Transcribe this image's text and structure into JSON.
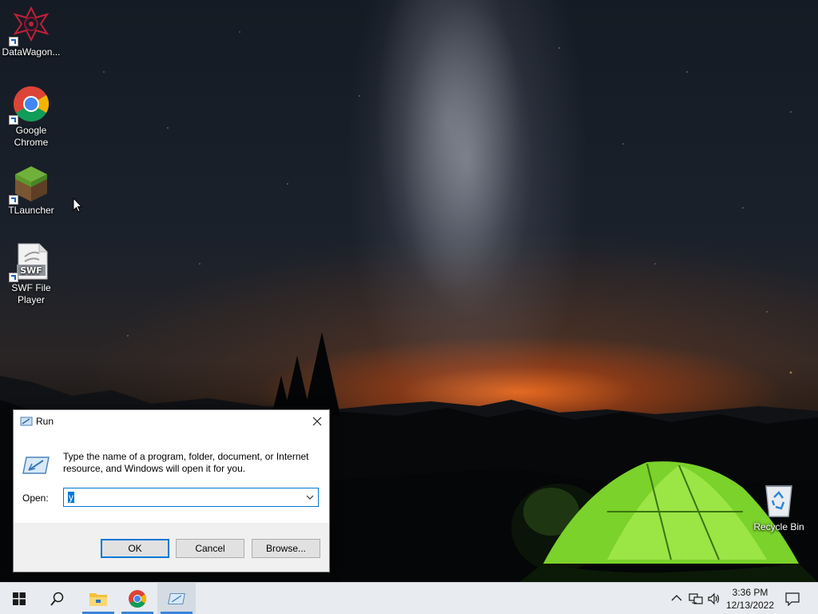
{
  "desktop": {
    "icons": [
      {
        "label": "DataWagon...",
        "icon": "datawagon-icon"
      },
      {
        "label": "Google\nChrome",
        "icon": "chrome-icon"
      },
      {
        "label": "TLauncher",
        "icon": "minecraft-grass-block-icon"
      },
      {
        "label": "SWF File\nPlayer",
        "icon": "swf-file-icon"
      },
      {
        "label": "Recycle Bin",
        "icon": "recycle-bin-icon"
      }
    ]
  },
  "run_dialog": {
    "title": "Run",
    "description": "Type the name of a program, folder, document, or Internet resource, and Windows will open it for you.",
    "open_label": "Open:",
    "open_value": "y",
    "buttons": {
      "ok": "OK",
      "cancel": "Cancel",
      "browse": "Browse..."
    }
  },
  "taskbar": {
    "items": [
      "start-icon",
      "search-icon",
      "file-explorer-icon",
      "chrome-icon",
      "run-icon"
    ],
    "clock": {
      "time": "3:36 PM",
      "date": "12/13/2022"
    },
    "accent": "#0078d7"
  }
}
